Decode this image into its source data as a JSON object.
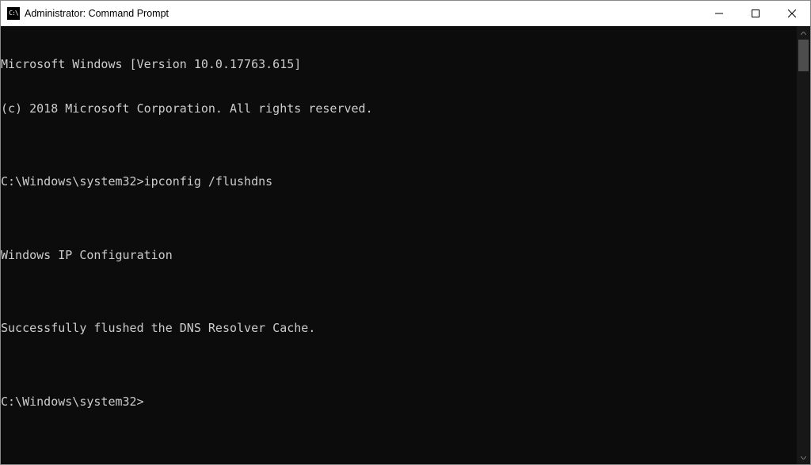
{
  "titlebar": {
    "icon_text": "C:\\",
    "title": "Administrator: Command Prompt"
  },
  "terminal": {
    "lines": [
      "Microsoft Windows [Version 10.0.17763.615]",
      "(c) 2018 Microsoft Corporation. All rights reserved.",
      "",
      "C:\\Windows\\system32>ipconfig /flushdns",
      "",
      "Windows IP Configuration",
      "",
      "Successfully flushed the DNS Resolver Cache.",
      "",
      "C:\\Windows\\system32>"
    ]
  }
}
